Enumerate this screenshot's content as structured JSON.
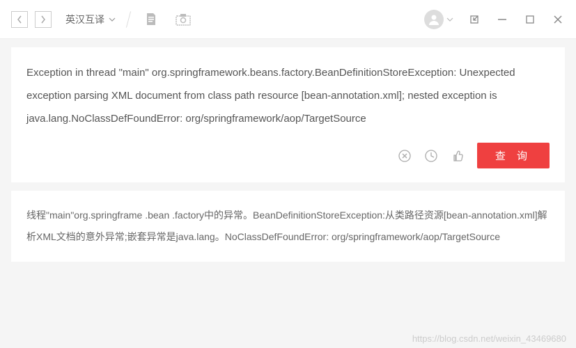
{
  "toolbar": {
    "mode_label": "英汉互译",
    "icons": {
      "back": "back-icon",
      "forward": "forward-icon",
      "document": "document-icon",
      "camera": "camera-icon",
      "avatar": "avatar-icon",
      "popout": "popout-icon",
      "minimize": "minimize-icon",
      "maximize": "maximize-icon",
      "close": "close-icon"
    }
  },
  "input": {
    "text": "Exception in thread \"main\" org.springframework.beans.factory.BeanDefinitionStoreException: Unexpected exception parsing XML document from class path resource [bean-annotation.xml]; nested exception is java.lang.NoClassDefFoundError: org/springframework/aop/TargetSource"
  },
  "actions": {
    "clear": "clear-icon",
    "history": "history-icon",
    "like": "like-icon",
    "query_label": "查 询"
  },
  "output": {
    "text": "线程\"main\"org.springframe .bean .factory中的异常。BeanDefinitionStoreException:从类路径资源[bean-annotation.xml]解析XML文档的意外异常;嵌套异常是java.lang。NoClassDefFoundError: org/springframework/aop/TargetSource"
  },
  "watermark": "https://blog.csdn.net/weixin_43469680"
}
